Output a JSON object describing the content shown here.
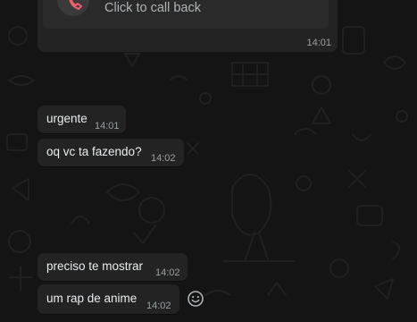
{
  "call_card": {
    "label": "Click to call back",
    "time": "14:01",
    "icon": "missed-call-icon"
  },
  "messages": [
    {
      "text": "urgente",
      "time": "14:01"
    },
    {
      "text": "oq vc ta fazendo?",
      "time": "14:02"
    },
    {
      "text": "preciso te mostrar",
      "time": "14:02"
    },
    {
      "text": "um rap de anime",
      "time": "14:02"
    }
  ],
  "actions": {
    "react_icon": "smiley-face-icon"
  },
  "colors": {
    "background": "#141414",
    "bubble": "#232323",
    "text": "#e9edef",
    "meta": "#9aa0a3",
    "call_accent": "#f15c6d"
  }
}
